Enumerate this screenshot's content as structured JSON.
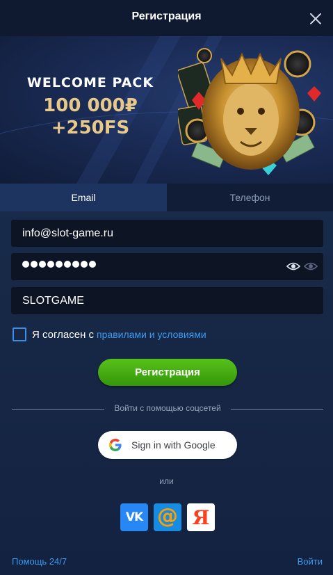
{
  "header": {
    "title": "Регистрация",
    "close_icon": "close-icon"
  },
  "banner": {
    "title": "WELCOME PACK",
    "amount": "100 000₽",
    "freespins": "+250FS",
    "accent_color": "#e8c98a"
  },
  "tabs": [
    {
      "label": "Email",
      "active": true
    },
    {
      "label": "Телефон",
      "active": false
    }
  ],
  "form": {
    "email_value": "info@slot-game.ru",
    "password_masked": "•••••••••",
    "promo_value": "SLOTGAME",
    "agree_text": "Я согласен с",
    "agree_link": "правилами и условиями",
    "checkbox_checked": false
  },
  "register_button": {
    "label": "Регистрация",
    "color": "#46ac13"
  },
  "social": {
    "divider_text": "Войти с помощью соцсетей",
    "google_label": "Sign in with Google",
    "or_text": "или",
    "providers": [
      {
        "name": "vk",
        "glyph": "VK",
        "color": "#2787f5"
      },
      {
        "name": "mail",
        "glyph": "@",
        "color": "#168de2"
      },
      {
        "name": "yandex",
        "glyph": "Я",
        "color": "#fc3f1d"
      }
    ]
  },
  "footer": {
    "help": "Помощь 24/7",
    "login": "Войти"
  }
}
